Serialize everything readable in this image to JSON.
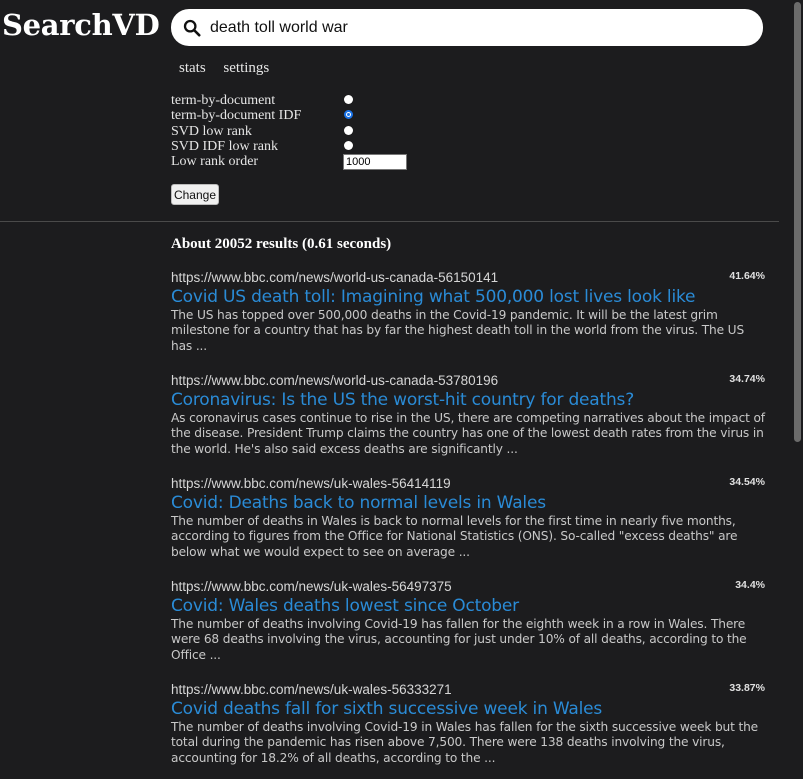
{
  "app": {
    "logo": "SearchVD"
  },
  "search": {
    "query": "death toll world war",
    "icon": "search-icon"
  },
  "nav": {
    "stats": "stats",
    "settings": "settings"
  },
  "options": {
    "items": [
      {
        "label": "term-by-document",
        "checked": false
      },
      {
        "label": "term-by-document IDF",
        "checked": true
      },
      {
        "label": "SVD low rank",
        "checked": false
      },
      {
        "label": "SVD IDF low rank",
        "checked": false
      }
    ],
    "low_rank_label": "Low rank order",
    "low_rank_value": "1000",
    "change_label": "Change"
  },
  "summary": {
    "text": "About 20052 results (0.61 seconds)"
  },
  "results": [
    {
      "url": "https://www.bbc.com/news/world-us-canada-56150141",
      "score": "41.64%",
      "title": "Covid US death toll: Imagining what 500,000 lost lives look like",
      "snippet": "The US has topped over 500,000 deaths in the Covid-19 pandemic. It will be the latest grim milestone for a country that has by far the highest death toll in the world from the virus. The US has ..."
    },
    {
      "url": "https://www.bbc.com/news/world-us-canada-53780196",
      "score": "34.74%",
      "title": "Coronavirus: Is the US the worst-hit country for deaths?",
      "snippet": "As coronavirus cases continue to rise in the US, there are competing narratives about the impact of the disease. President Trump claims the country has one of the lowest death rates from the virus in the world. He's also said excess deaths are significantly ..."
    },
    {
      "url": "https://www.bbc.com/news/uk-wales-56414119",
      "score": "34.54%",
      "title": "Covid: Deaths back to normal levels in Wales",
      "snippet": "The number of deaths in Wales is back to normal levels for the first time in nearly five months, according to figures from the Office for National Statistics (ONS). So-called \"excess deaths\" are below what we would expect to see on average ..."
    },
    {
      "url": "https://www.bbc.com/news/uk-wales-56497375",
      "score": "34.4%",
      "title": "Covid: Wales deaths lowest since October",
      "snippet": "The number of deaths involving Covid-19 has fallen for the eighth week in a row in Wales. There were 68 deaths involving the virus, accounting for just under 10% of all deaths, according to the Office ..."
    },
    {
      "url": "https://www.bbc.com/news/uk-wales-56333271",
      "score": "33.87%",
      "title": "Covid deaths fall for sixth successive week in Wales",
      "snippet": "The number of deaths involving Covid-19 in Wales has fallen for the sixth successive week but the total during the pandemic has risen above 7,500. There were 138 deaths involving the virus, accounting for 18.2% of all deaths, according to the ..."
    }
  ],
  "colors": {
    "background": "#1c1c1e",
    "link": "#2a8bd6",
    "radio_checked": "#1a73e8"
  }
}
